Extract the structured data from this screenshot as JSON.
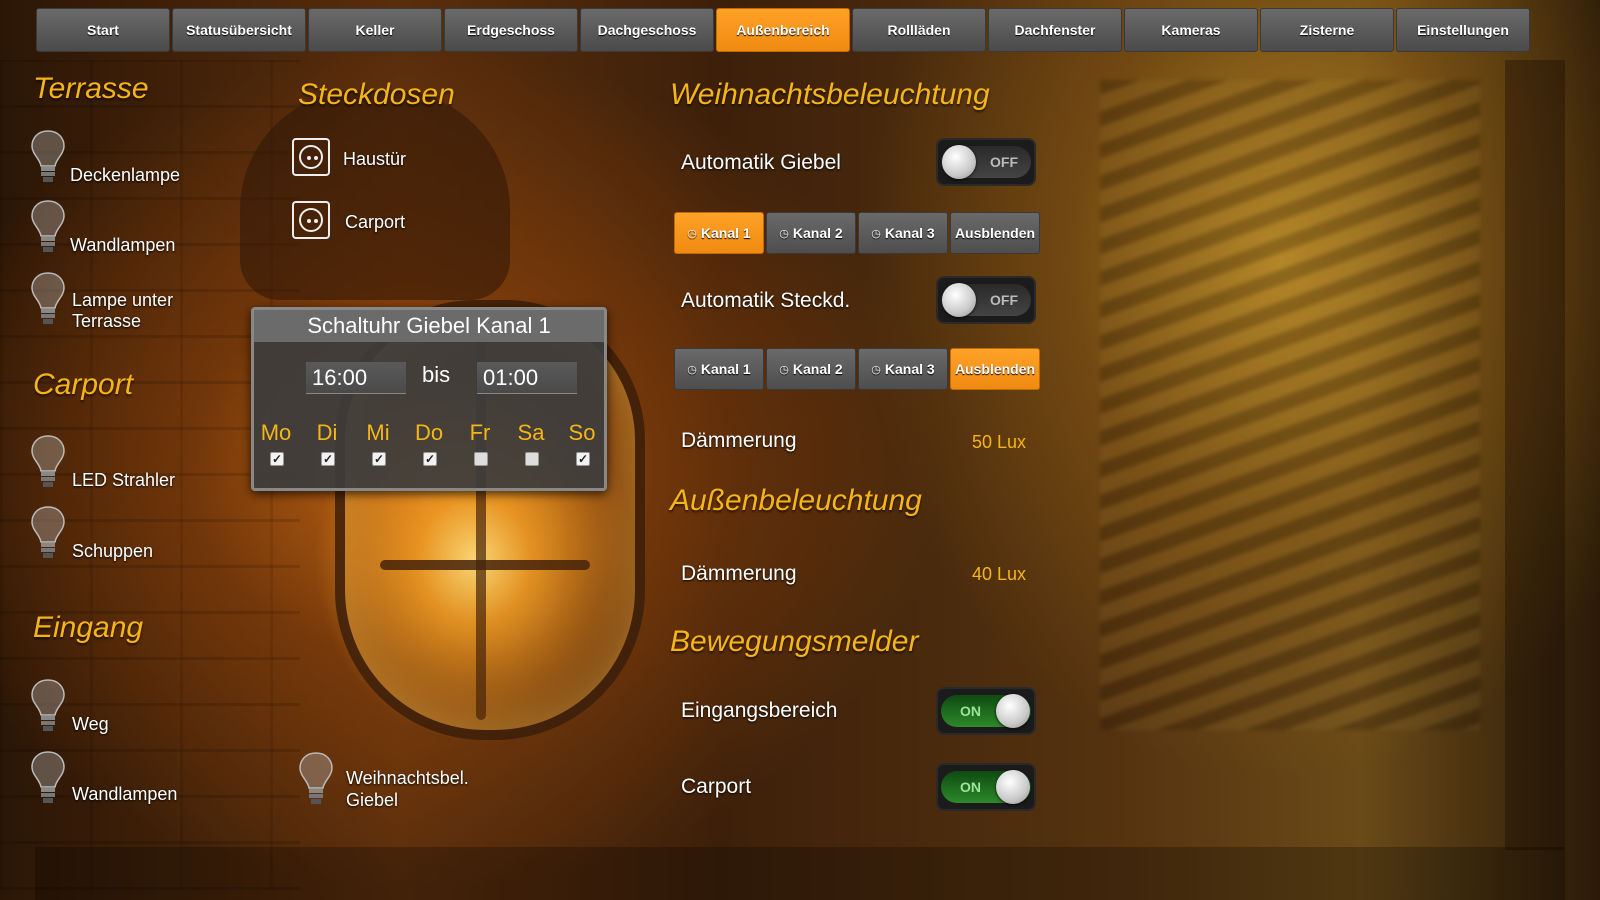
{
  "nav": {
    "tabs": [
      {
        "label": "Start"
      },
      {
        "label": "Statusübersicht"
      },
      {
        "label": "Keller"
      },
      {
        "label": "Erdgeschoss"
      },
      {
        "label": "Dachgeschoss"
      },
      {
        "label": "Außenbereich",
        "active": true
      },
      {
        "label": "Rollläden"
      },
      {
        "label": "Dachfenster"
      },
      {
        "label": "Kameras"
      },
      {
        "label": "Zisterne"
      },
      {
        "label": "Einstellungen"
      }
    ]
  },
  "terrasse": {
    "heading": "Terrasse",
    "items": [
      {
        "label": "Deckenlampe",
        "icon": "bulb-icon"
      },
      {
        "label": "Wandlampen",
        "icon": "bulb-icon"
      },
      {
        "label_line1": "Lampe unter",
        "label_line2": "Terrasse",
        "icon": "bulb-icon"
      }
    ]
  },
  "carport": {
    "heading": "Carport",
    "items": [
      {
        "label": "LED Strahler",
        "icon": "bulb-icon"
      },
      {
        "label": "Schuppen",
        "icon": "bulb-icon"
      }
    ]
  },
  "eingang": {
    "heading": "Eingang",
    "items": [
      {
        "label": "Weg",
        "icon": "bulb-icon"
      },
      {
        "label": "Wandlampen",
        "icon": "bulb-icon"
      }
    ]
  },
  "giebel": {
    "label_line1": "Weihnachtsbel.",
    "label_line2": "Giebel",
    "icon": "bulb-icon"
  },
  "steckdosen": {
    "heading": "Steckdosen",
    "items": [
      {
        "label": "Haustür",
        "icon": "socket-icon"
      },
      {
        "label": "Carport",
        "icon": "socket-icon"
      }
    ]
  },
  "timer": {
    "title": "Schaltuhr Giebel Kanal 1",
    "from": "16:00",
    "bis": "bis",
    "to": "01:00",
    "days": [
      {
        "label": "Mo",
        "checked": true
      },
      {
        "label": "Di",
        "checked": true
      },
      {
        "label": "Mi",
        "checked": true
      },
      {
        "label": "Do",
        "checked": true
      },
      {
        "label": "Fr",
        "checked": false
      },
      {
        "label": "Sa",
        "checked": false
      },
      {
        "label": "So",
        "checked": true
      }
    ]
  },
  "weihnacht": {
    "heading": "Weihnachtsbeleuchtung",
    "automatik_giebel": {
      "label": "Automatik Giebel",
      "state": "OFF"
    },
    "giebel_channels": [
      {
        "label": "Kanal 1",
        "icon": "clock-icon",
        "active": true
      },
      {
        "label": "Kanal 2",
        "icon": "clock-icon",
        "active": false
      },
      {
        "label": "Kanal 3",
        "icon": "clock-icon",
        "active": false
      },
      {
        "label": "Ausblenden",
        "active": false
      }
    ],
    "automatik_steckd": {
      "label": "Automatik Steckd.",
      "state": "OFF"
    },
    "steckd_channels": [
      {
        "label": "Kanal 1",
        "icon": "clock-icon",
        "active": false
      },
      {
        "label": "Kanal 2",
        "icon": "clock-icon",
        "active": false
      },
      {
        "label": "Kanal 3",
        "icon": "clock-icon",
        "active": false
      },
      {
        "label": "Ausblenden",
        "active": true
      }
    ],
    "daemmerung": {
      "label": "Dämmerung",
      "value": "50 Lux"
    }
  },
  "aussen": {
    "heading": "Außenbeleuchtung",
    "daemmerung": {
      "label": "Dämmerung",
      "value": "40 Lux"
    }
  },
  "bewegung": {
    "heading": "Bewegungsmelder",
    "eingangsbereich": {
      "label": "Eingangsbereich",
      "state": "ON"
    },
    "carport": {
      "label": "Carport",
      "state": "ON"
    }
  },
  "colors": {
    "accent": "#f6b517",
    "active_tab": "#f08a10",
    "button": "#5a5a5a"
  }
}
